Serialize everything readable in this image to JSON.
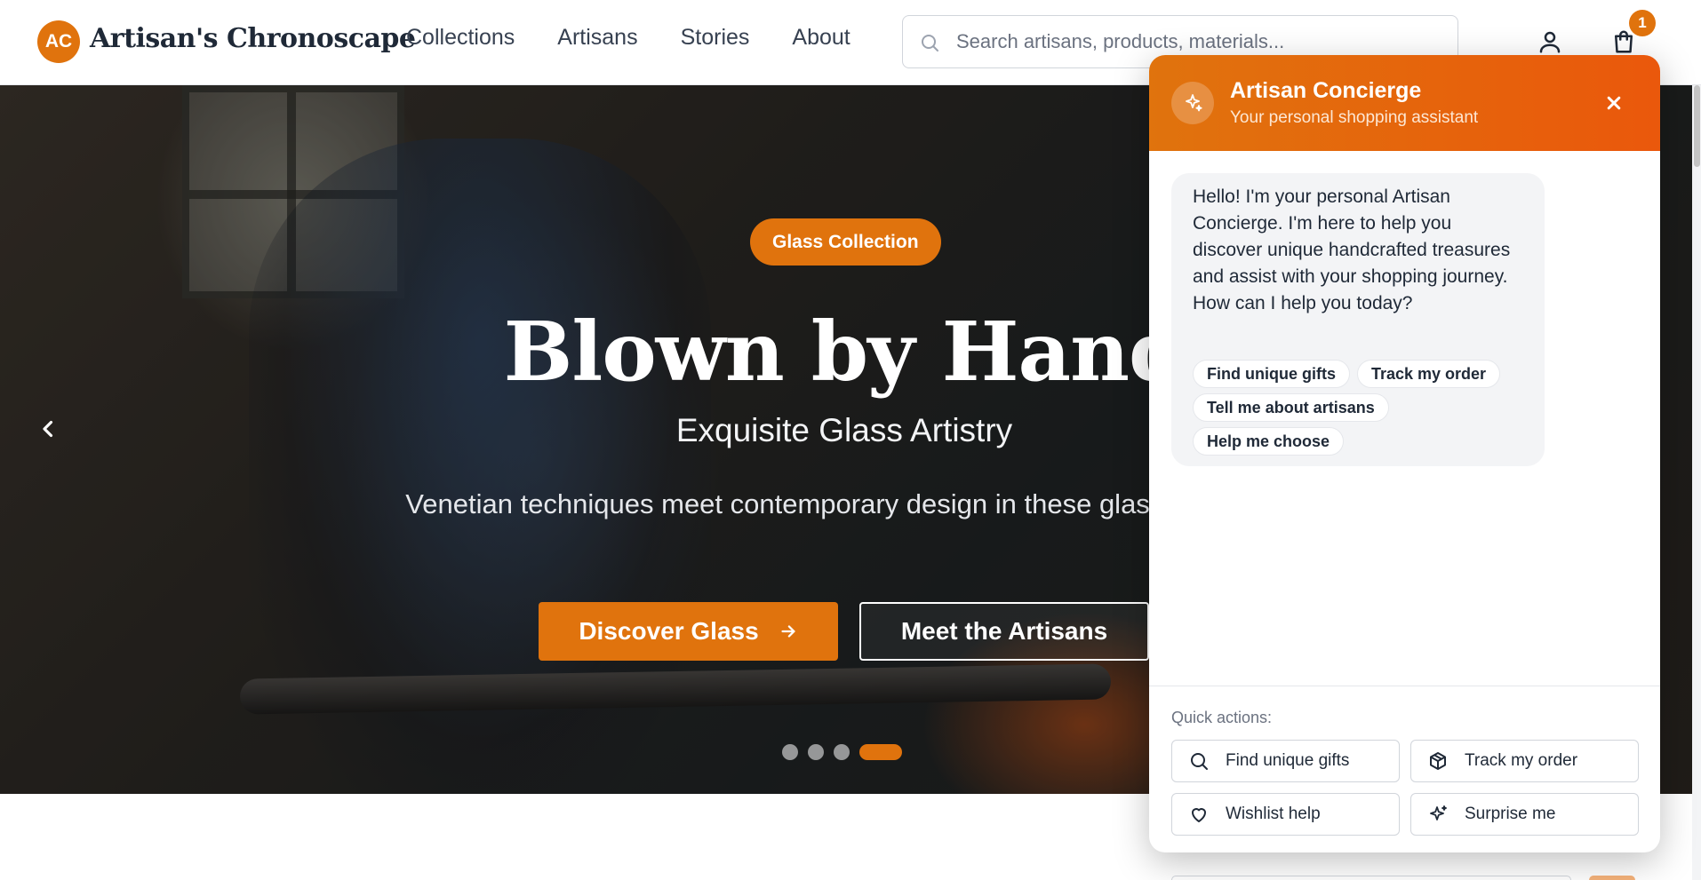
{
  "header": {
    "logo_initials": "AC",
    "brand": "Artisan's Chronoscape",
    "nav": [
      "Collections",
      "Artisans",
      "Stories",
      "About"
    ],
    "search_placeholder": "Search artisans, products, materials...",
    "cart_count": "1",
    "icons": [
      "search-icon",
      "user-icon",
      "shopping-bag-icon"
    ]
  },
  "hero": {
    "badge": "Glass Collection",
    "title": "Blown by Hand",
    "subtitle": "Exquisite Glass Artistry",
    "description": "Venetian techniques meet contemporary design in these glass creations",
    "primary_button": "Discover Glass",
    "secondary_button": "Meet the Artisans",
    "slide_count": 4,
    "active_slide": 4
  },
  "chat": {
    "title": "Artisan Concierge",
    "subtitle": "Your personal shopping assistant",
    "greeting": "Hello! I'm your personal Artisan Concierge. I'm here to help you discover unique handcrafted treasures and assist with your shopping journey. How can I help you today?",
    "suggestions": [
      "Find unique gifts",
      "Track my order",
      "Tell me about artisans",
      "Help me choose"
    ],
    "quick_actions_label": "Quick actions:",
    "quick_actions": [
      {
        "label": "Find unique gifts",
        "icon": "search-icon"
      },
      {
        "label": "Track my order",
        "icon": "package-icon"
      },
      {
        "label": "Wishlist help",
        "icon": "heart-icon"
      },
      {
        "label": "Surprise me",
        "icon": "sparkles-icon"
      }
    ]
  },
  "colors": {
    "accent": "#e0730d",
    "accent_dark": "#ea580c"
  }
}
